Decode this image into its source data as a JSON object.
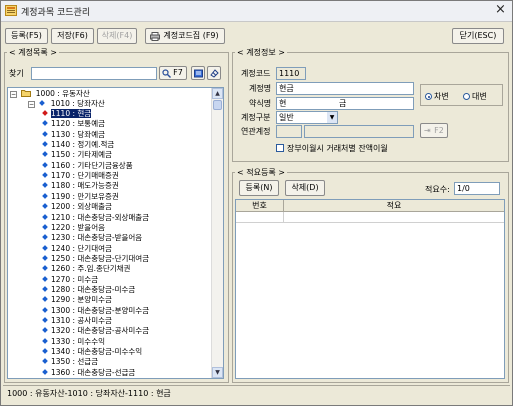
{
  "window": {
    "title": "계정과목 코드관리"
  },
  "toolbar": {
    "register": "등록(F5)",
    "save": "저장(F6)",
    "delete": "삭제(F4)",
    "print": "계정코드집 (F9)",
    "close": "닫기(ESC)"
  },
  "account_list": {
    "title": "< 계정목록 >",
    "search_label": "찾기",
    "search_value": "",
    "find_button": "F7",
    "tree": {
      "root": "1000 : 유동자산",
      "child": "1010 : 당좌자산",
      "items": [
        {
          "code": "1110",
          "name": "현금",
          "selected": true
        },
        {
          "code": "1120",
          "name": "보통예금"
        },
        {
          "code": "1130",
          "name": "당좌예금"
        },
        {
          "code": "1140",
          "name": "정기예.적금"
        },
        {
          "code": "1150",
          "name": "기타제예금"
        },
        {
          "code": "1160",
          "name": "기타단기금융상품"
        },
        {
          "code": "1170",
          "name": "단기매매증권"
        },
        {
          "code": "1180",
          "name": "매도가능증권"
        },
        {
          "code": "1190",
          "name": "만기보유증권"
        },
        {
          "code": "1200",
          "name": "외상매출금"
        },
        {
          "code": "1210",
          "name": "대손충당금-외상매출금"
        },
        {
          "code": "1220",
          "name": "받을어음"
        },
        {
          "code": "1230",
          "name": "대손충당금-받을어음"
        },
        {
          "code": "1240",
          "name": "단기대여금"
        },
        {
          "code": "1250",
          "name": "대손충당금-단기대여금"
        },
        {
          "code": "1260",
          "name": "주.임.종단기채권"
        },
        {
          "code": "1270",
          "name": "미수금"
        },
        {
          "code": "1280",
          "name": "대손충당금-미수금"
        },
        {
          "code": "1290",
          "name": "분양미수금"
        },
        {
          "code": "1300",
          "name": "대손충당금-분양미수금"
        },
        {
          "code": "1310",
          "name": "공사미수금"
        },
        {
          "code": "1320",
          "name": "대손충당금-공사미수금"
        },
        {
          "code": "1330",
          "name": "미수수익"
        },
        {
          "code": "1340",
          "name": "대손충당금-미수수익"
        },
        {
          "code": "1350",
          "name": "선급금"
        },
        {
          "code": "1360",
          "name": "대손충당금-선급금"
        }
      ]
    }
  },
  "account_info": {
    "title": "< 계정정보 >",
    "code_label": "계정코드",
    "code_value": "1110",
    "name_label": "계정명",
    "name_value": "현금",
    "short_label": "약식명",
    "short_value_1": "현",
    "short_value_2": "금",
    "type_label": "계정구분",
    "type_value": "일반",
    "link_label": "연관계정",
    "link_code": "",
    "link_name": "",
    "link_button": "F2",
    "debit_label": "차변",
    "credit_label": "대변",
    "checkbox_label": "장부이월시 거래처별 잔액이월"
  },
  "memo": {
    "title": "< 적요등록 >",
    "register_button": "등록(N)",
    "delete_button": "삭제(D)",
    "count_label": "적요수:",
    "count_value": "1/0",
    "columns": [
      "번호",
      "적요"
    ]
  },
  "status": "1000 : 유동자산-1010 : 당좌자산-1110 : 현금"
}
